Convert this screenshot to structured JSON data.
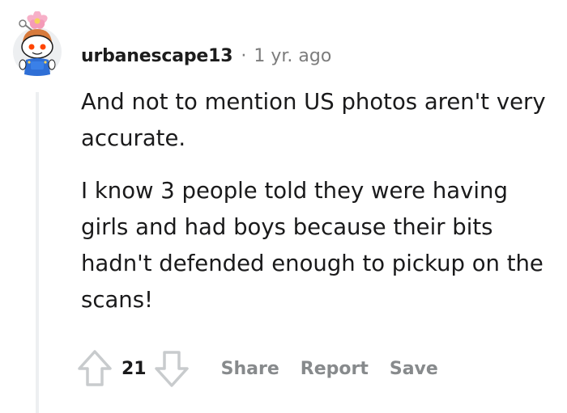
{
  "comment": {
    "author": "urbanescape13",
    "separator": "·",
    "timestamp": "1 yr. ago",
    "paragraphs": [
      "And not to mention US photos aren't very accurate.",
      "I know 3 people told they were having girls and had boys because their bits hadn't defended enough to pickup on the scans!"
    ],
    "score": "21",
    "actions": {
      "share": "Share",
      "report": "Report",
      "save": "Save"
    }
  },
  "icons": {
    "avatar": "reddit-snoo-avatar",
    "upvote": "upvote-arrow-icon",
    "downvote": "downvote-arrow-icon"
  },
  "colors": {
    "text": "#1a1a1b",
    "muted": "#7c7c7c",
    "action": "#878a8c",
    "thread_line": "#edeff1",
    "arrow": "#c8cbcd"
  }
}
